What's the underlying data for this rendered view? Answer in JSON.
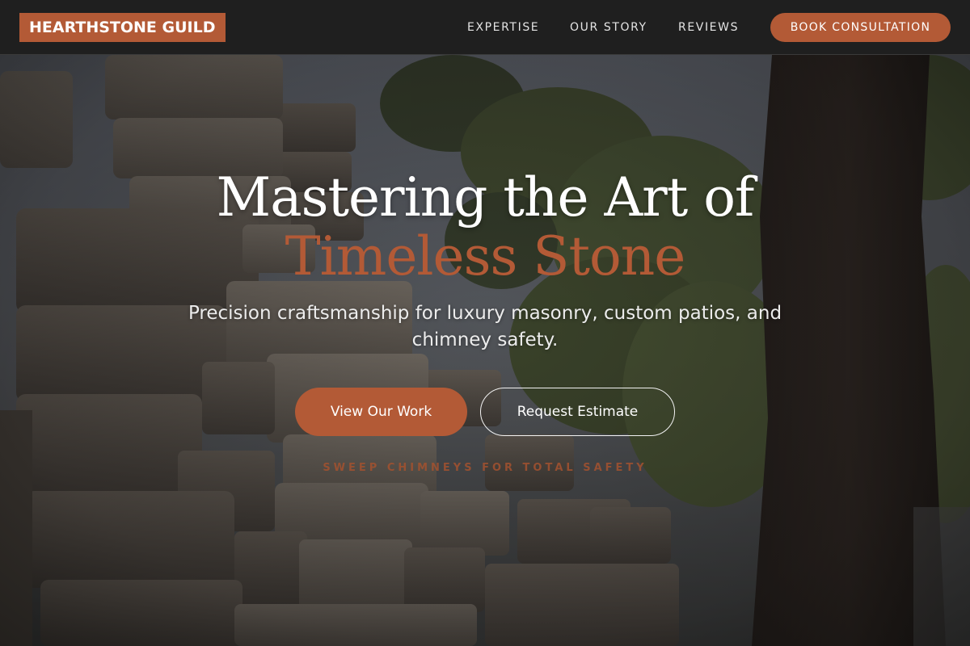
{
  "brand": {
    "name": "HEARTHSTONE GUILD",
    "accent_color": "#b35a36"
  },
  "nav": {
    "items": [
      {
        "label": "EXPERTISE"
      },
      {
        "label": "OUR STORY"
      },
      {
        "label": "REVIEWS"
      }
    ],
    "cta_label": "BOOK CONSULTATION"
  },
  "hero": {
    "background_image": "stacked-stone-blocks-with-trees",
    "headline_line1": "Mastering the Art of",
    "headline_line2": "Timeless Stone",
    "subtitle": "Precision craftsmanship for luxury masonry, custom patios, and chimney safety.",
    "primary_button": "View Our Work",
    "secondary_button": "Request Estimate",
    "tagline": "SWEEP CHIMNEYS FOR TOTAL SAFETY"
  }
}
